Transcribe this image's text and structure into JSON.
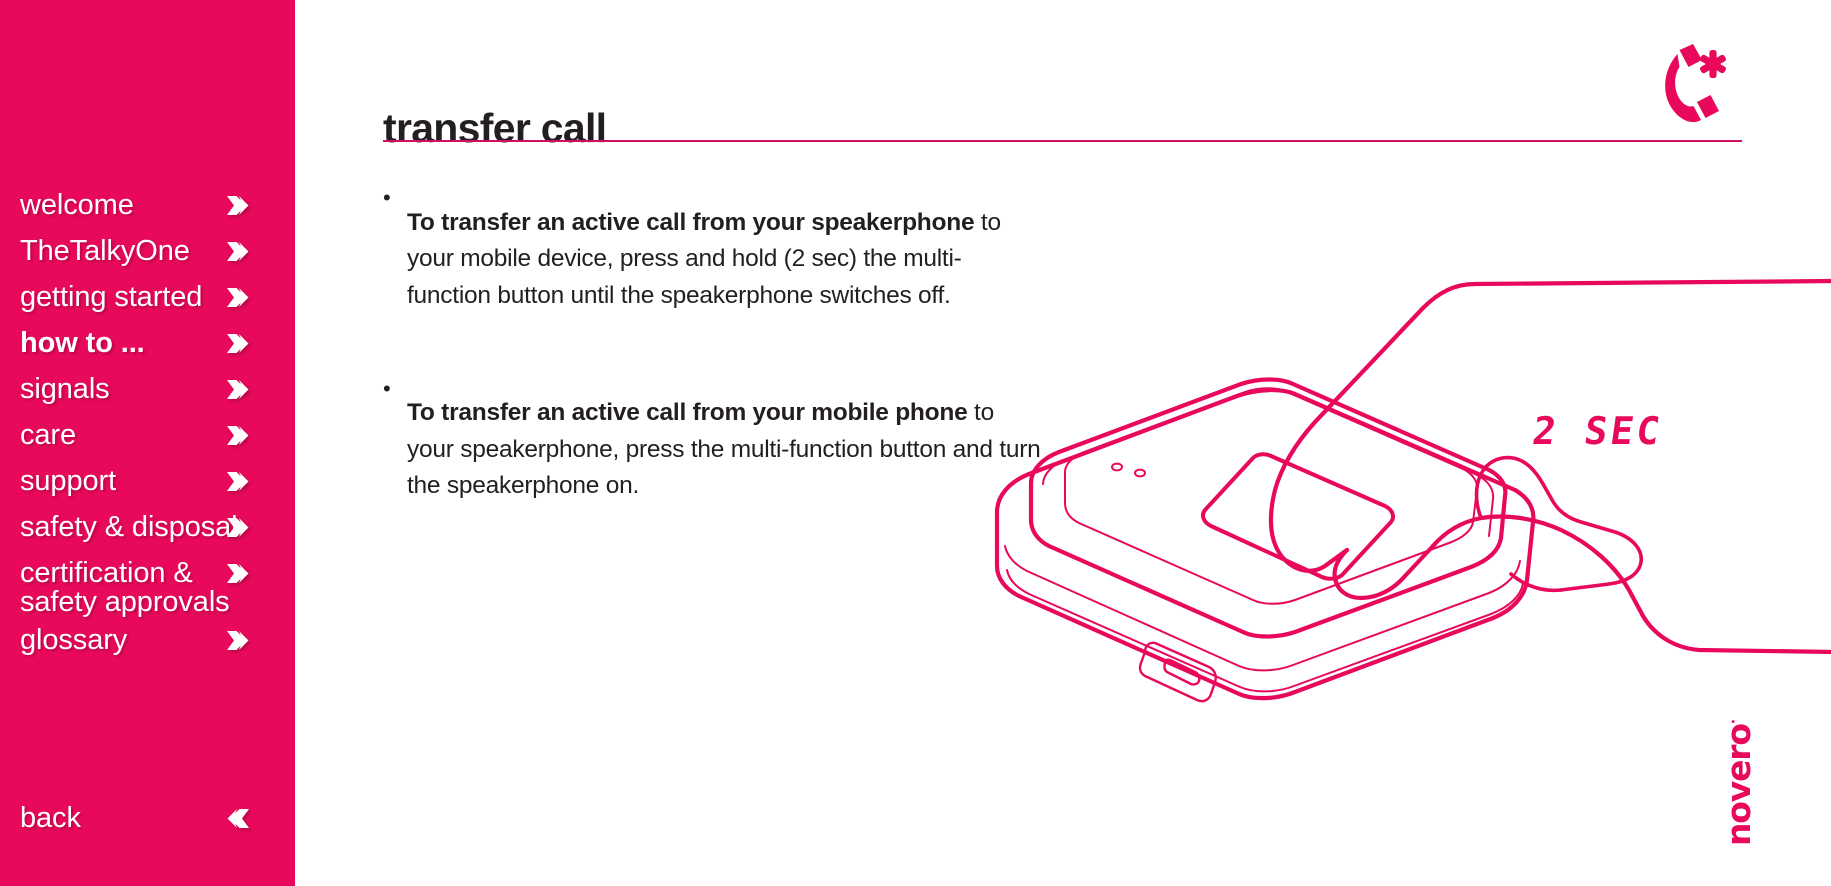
{
  "theme": {
    "brand_pink": "#e8095c",
    "rule_pink": "#cf1060",
    "text_dark": "#231f20",
    "page_bg": "#ffffff"
  },
  "sidebar": {
    "items": [
      {
        "label": "welcome",
        "icon": "chevron-right-icon",
        "current": false
      },
      {
        "label": "TheTalkyOne",
        "icon": "chevron-right-icon",
        "current": false
      },
      {
        "label": "getting started",
        "icon": "chevron-right-icon",
        "current": false
      },
      {
        "label": "how to ...",
        "icon": "chevron-right-icon",
        "current": true
      },
      {
        "label": "signals",
        "icon": "chevron-right-icon",
        "current": false
      },
      {
        "label": "care",
        "icon": "chevron-right-icon",
        "current": false
      },
      {
        "label": "support",
        "icon": "chevron-right-icon",
        "current": false
      },
      {
        "label": "safety & disposal",
        "icon": "chevron-right-icon",
        "current": false
      },
      {
        "label": "certification &\nsafety approvals",
        "icon": "chevron-right-icon",
        "current": false
      },
      {
        "label": "glossary",
        "icon": "chevron-right-icon",
        "current": false
      }
    ],
    "back": {
      "label": "back",
      "icon": "chevron-left-icon"
    }
  },
  "header": {
    "title": "transfer call",
    "icon": "phone-handset-star-icon"
  },
  "content": {
    "bullet_marker": "•",
    "bullets": [
      {
        "lead": "To transfer an active call from your speakerphone",
        "rest": " to your mobile device, press and hold (2 sec) the multi-function button until the speakerphone switches off."
      },
      {
        "lead": "To transfer an active call from your mobile phone",
        "rest": " to your speakerphone, press the multi-function button and turn the speakerphone on."
      }
    ]
  },
  "illustration": {
    "name": "hand-pressing-speakerphone-button",
    "duration_label": "2 SEC",
    "stroke_color": "#e8095c"
  },
  "footer": {
    "logo_text": "novero",
    "logo_mark": "·"
  }
}
